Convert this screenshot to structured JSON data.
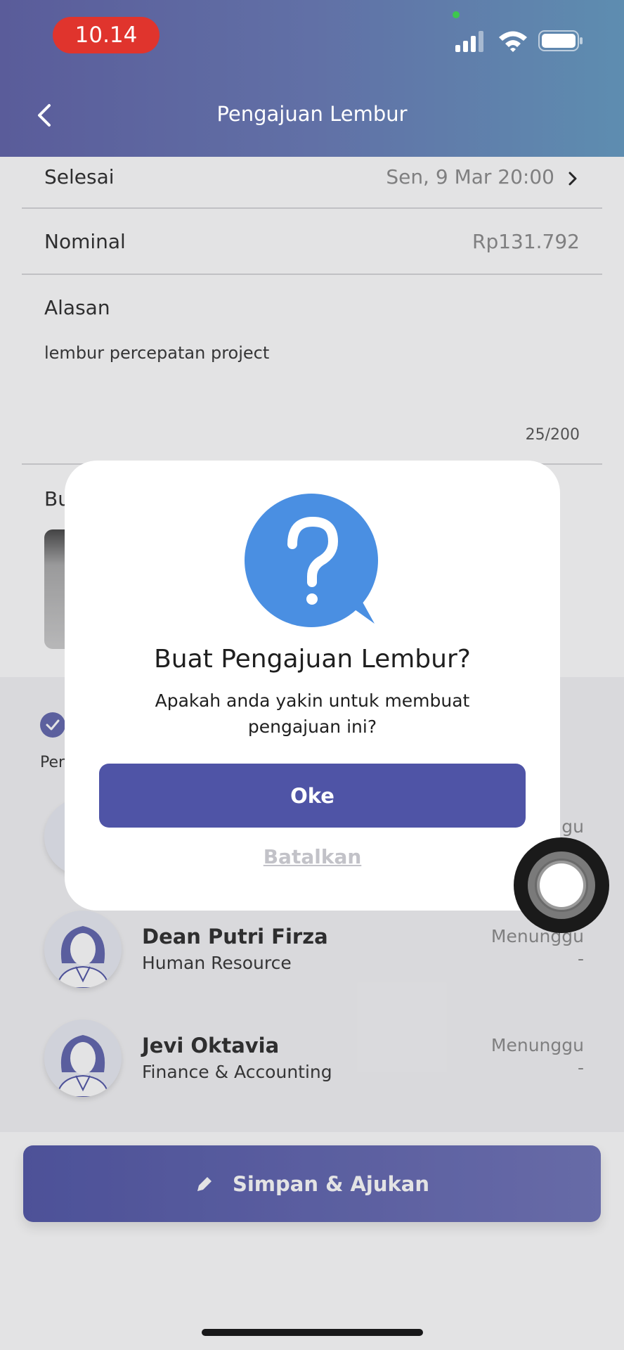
{
  "status_bar": {
    "time": "10.14"
  },
  "header": {
    "title": "Pengajuan Lembur"
  },
  "form": {
    "selesai": {
      "label": "Selesai",
      "value": "Sen, 9 Mar 20:00"
    },
    "nominal": {
      "label": "Nominal",
      "value": "Rp131.792"
    },
    "alasan": {
      "label": "Alasan",
      "value": "lembur percepatan project",
      "counter": "25/200"
    },
    "bukti_label": "Bu",
    "per_label": "Per"
  },
  "approvers": [
    {
      "name": "",
      "role": "",
      "status": "nggu",
      "dash": ""
    },
    {
      "name": "Dean Putri Firza",
      "role": "Human Resource",
      "status": "Menunggu",
      "dash": "-"
    },
    {
      "name": "Jevi Oktavia",
      "role": "Finance & Accounting",
      "status": "Menunggu",
      "dash": "-"
    }
  ],
  "submit_button": {
    "label": "Simpan & Ajukan"
  },
  "dialog": {
    "title": "Buat Pengajuan Lembur?",
    "message": "Apakah anda yakin untuk membuat pengajuan ini?",
    "ok_label": "Oke",
    "cancel_label": "Batalkan"
  },
  "colors": {
    "primary": "#4f54a6",
    "accent_blue": "#4a8fe2",
    "status_red": "#e0342d"
  }
}
